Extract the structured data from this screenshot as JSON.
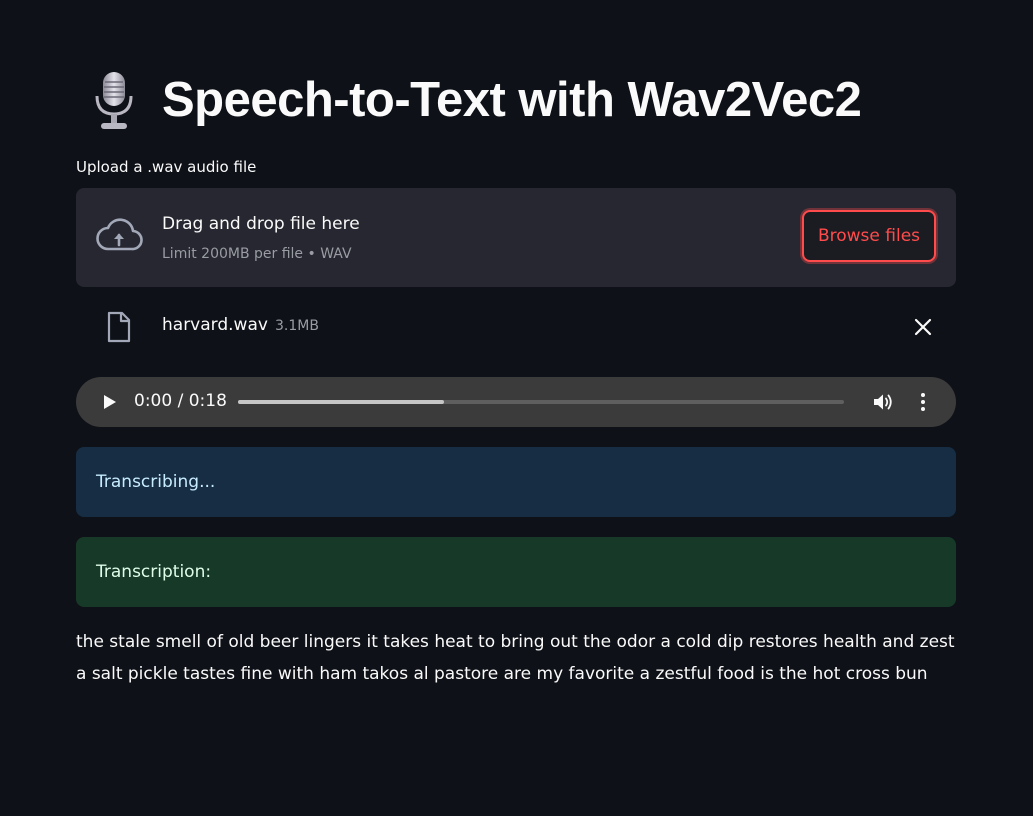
{
  "header": {
    "title": "Speech-to-Text with Wav2Vec2",
    "icon": "microphone-icon"
  },
  "uploader": {
    "label": "Upload a .wav audio file",
    "drop_text": "Drag and drop file here",
    "limit_text": "Limit 200MB per file • WAV",
    "browse_label": "Browse files",
    "accent_color": "#ff4b4b"
  },
  "uploaded_file": {
    "name": "harvard.wav",
    "size": "3.1MB"
  },
  "audio_player": {
    "time": "0:00 / 0:18",
    "progress": 0.34
  },
  "status": {
    "info": "Transcribing...",
    "success": "Transcription:"
  },
  "transcription": {
    "text": "the stale smell of old beer lingers it takes heat to bring out the odor a cold dip restores health and zest a salt pickle tastes fine with ham takos al pastore are my favorite a zestful food is the hot cross bun"
  }
}
